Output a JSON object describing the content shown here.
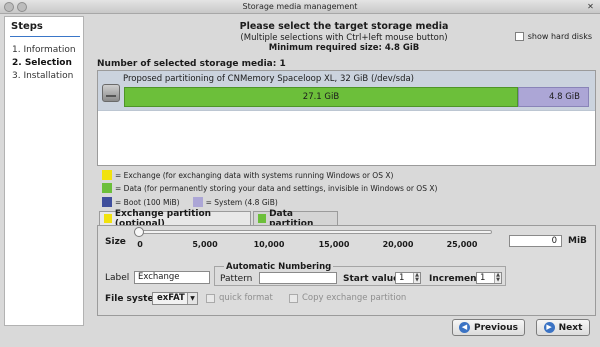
{
  "window": {
    "title": "Storage media management"
  },
  "sidebar": {
    "title": "Steps",
    "steps": [
      "1. Information",
      "2. Selection",
      "3. Installation"
    ]
  },
  "header": {
    "line1": "Please select the target storage media",
    "line2": "(Multiple selections with Ctrl+left mouse button)",
    "line3": "Minimum required size: 4.8 GiB"
  },
  "show_hard_disks": {
    "label": "show hard disks",
    "checked": false
  },
  "selected_count": "Number of selected storage media: 1",
  "media": {
    "label": "Proposed partitioning of CNMemory Spaceloop XL, 32 GiB (/dev/sda)",
    "data_partition": "27.1 GiB",
    "system_partition": "4.8 GiB"
  },
  "legend": {
    "exchange": "= Exchange (for exchanging data with systems running Windows or OS X)",
    "data": "= Data (for permanently storing your data and settings, invisible in Windows or OS X)",
    "boot": "= Boot (100 MiB)",
    "system": "= System (4.8 GiB)"
  },
  "colors": {
    "exchange": "#f1e20d",
    "data": "#6cbf3a",
    "boot": "#3f4e9c",
    "system": "#aca6d6"
  },
  "tabs": {
    "exchange": "Exchange partition (optional)",
    "data": "Data partition"
  },
  "exchange_partition": {
    "size_label": "Size",
    "slider_ticks": [
      "0",
      "5,000",
      "10,000",
      "15,000",
      "20,000",
      "25,000"
    ],
    "size_value": "0",
    "size_unit": "MiB",
    "label_label": "Label",
    "label_value": "Exchange",
    "auto_numbering_title": "Automatic Numbering",
    "pattern_label": "Pattern",
    "pattern_value": "",
    "start_value_label": "Start value",
    "start_value": "1",
    "increment_label": "Increment",
    "increment_value": "1",
    "file_system_label": "File system",
    "file_system_value": "exFAT",
    "quick_format_label": "quick format",
    "copy_exchange_label": "Copy exchange partition"
  },
  "buttons": {
    "previous": "Previous",
    "next": "Next"
  }
}
